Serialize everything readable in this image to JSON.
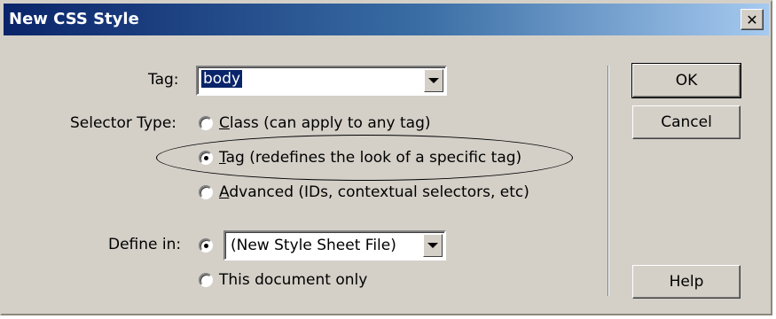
{
  "window": {
    "title": "New CSS Style",
    "close_glyph": "✕"
  },
  "tag_field": {
    "label": "Tag:",
    "value": "body"
  },
  "selector_type": {
    "label": "Selector Type:",
    "options": [
      {
        "access_key": "C",
        "rest": "lass (can apply to any tag)",
        "selected": false
      },
      {
        "access_key": "T",
        "rest": "ag (redefines the look of a specific tag)",
        "selected": true
      },
      {
        "access_key": "A",
        "rest": "dvanced (IDs, contextual selectors, etc)",
        "selected": false
      }
    ]
  },
  "define_in": {
    "label": "Define in:",
    "combo_value": "(New Style Sheet File)",
    "other_option": "This document only",
    "selected": "new_file"
  },
  "buttons": {
    "ok": "OK",
    "cancel": "Cancel",
    "help": "Help"
  },
  "icons": {
    "dropdown": "chevron-down-icon",
    "close": "close-icon"
  }
}
